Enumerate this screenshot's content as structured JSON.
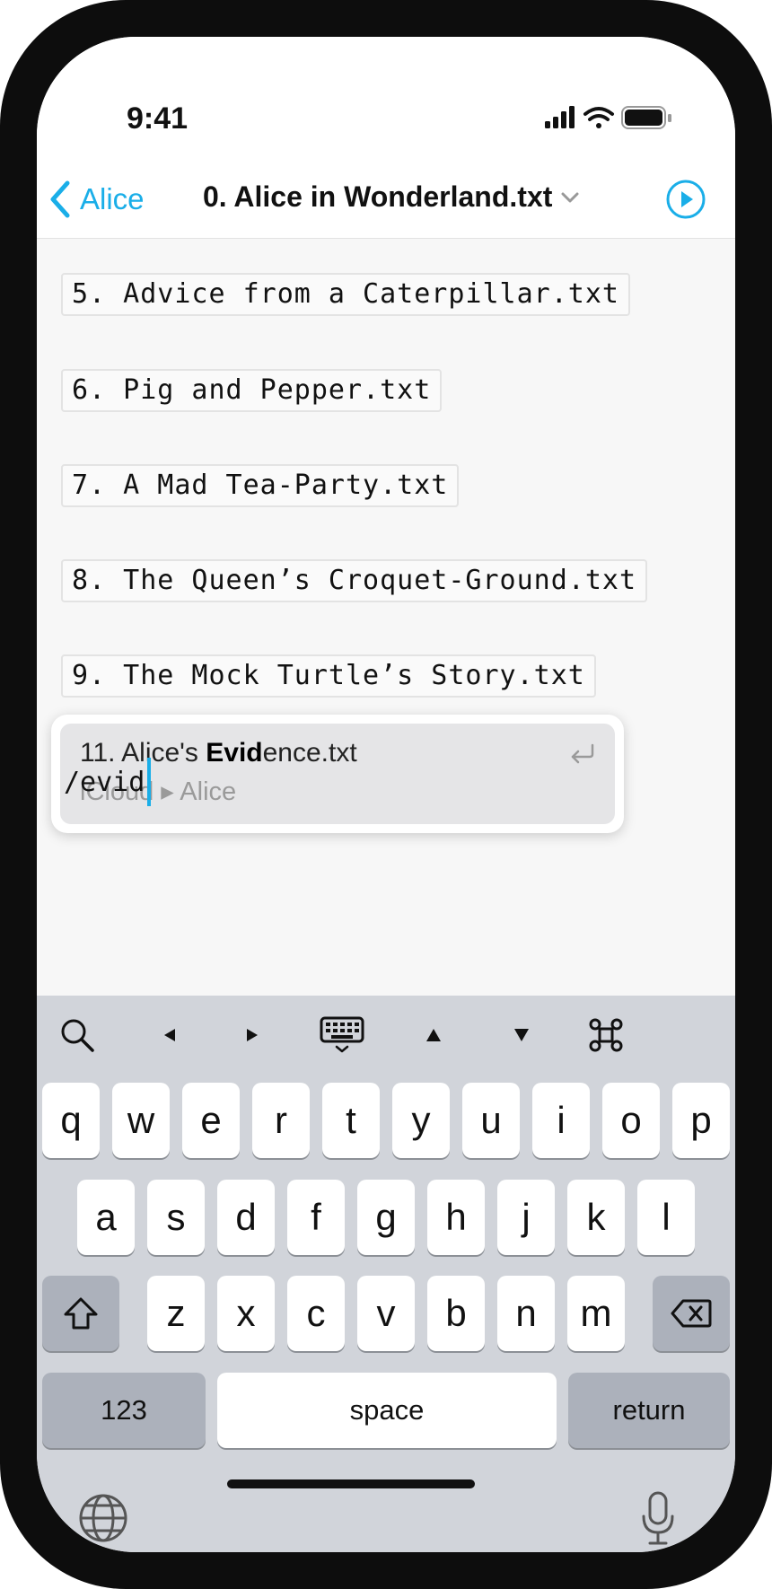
{
  "status_bar": {
    "time": "9:41",
    "icons": [
      "cellular-signal-icon",
      "wifi-icon",
      "battery-icon"
    ]
  },
  "nav": {
    "back_label": "Alice",
    "title": "0. Alice in Wonderland.txt",
    "run_icon": "play-circle-icon",
    "accent_color": "#1aaee8"
  },
  "editor": {
    "file_links": [
      "5. Advice from a Caterpillar.txt",
      "6. Pig and Pepper.txt",
      "7. A Mad Tea-Party.txt",
      "8. The Queen’s Croquet-Ground.txt",
      "9. The Mock Turtle’s Story.txt"
    ],
    "suggestion": {
      "prefix": "11. Alice's ",
      "match": "Evid",
      "suffix": "ence.txt",
      "location": "iCloud ▸ Alice"
    },
    "typed_text": "/evid"
  },
  "keyboard": {
    "toolbar": [
      "search-icon",
      "left-arrow-icon",
      "right-arrow-icon",
      "hide-keyboard-icon",
      "up-arrow-icon",
      "down-arrow-icon",
      "command-icon"
    ],
    "row1": [
      "q",
      "w",
      "e",
      "r",
      "t",
      "y",
      "u",
      "i",
      "o",
      "p"
    ],
    "row2": [
      "a",
      "s",
      "d",
      "f",
      "g",
      "h",
      "j",
      "k",
      "l"
    ],
    "row3": [
      "z",
      "x",
      "c",
      "v",
      "b",
      "n",
      "m"
    ],
    "numbers_label": "123",
    "space_label": "space",
    "return_label": "return"
  }
}
